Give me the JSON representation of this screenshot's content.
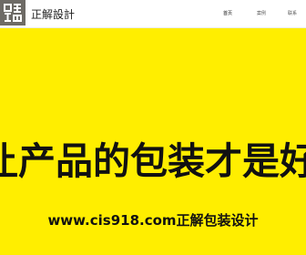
{
  "colors": {
    "accent": "#ffee00",
    "text": "#111111",
    "logo_bg": "#6e6b66"
  },
  "header": {
    "logo_icon": "seal-logo-icon",
    "brand_name": "正解設計",
    "nav": [
      {
        "label": "首页",
        "active": true
      },
      {
        "label": "案例",
        "active": false
      },
      {
        "label": "联系",
        "active": false
      }
    ]
  },
  "hero": {
    "headline": "让产品的包装才是好子",
    "subline": "www.cis918.com正解包装设计"
  }
}
